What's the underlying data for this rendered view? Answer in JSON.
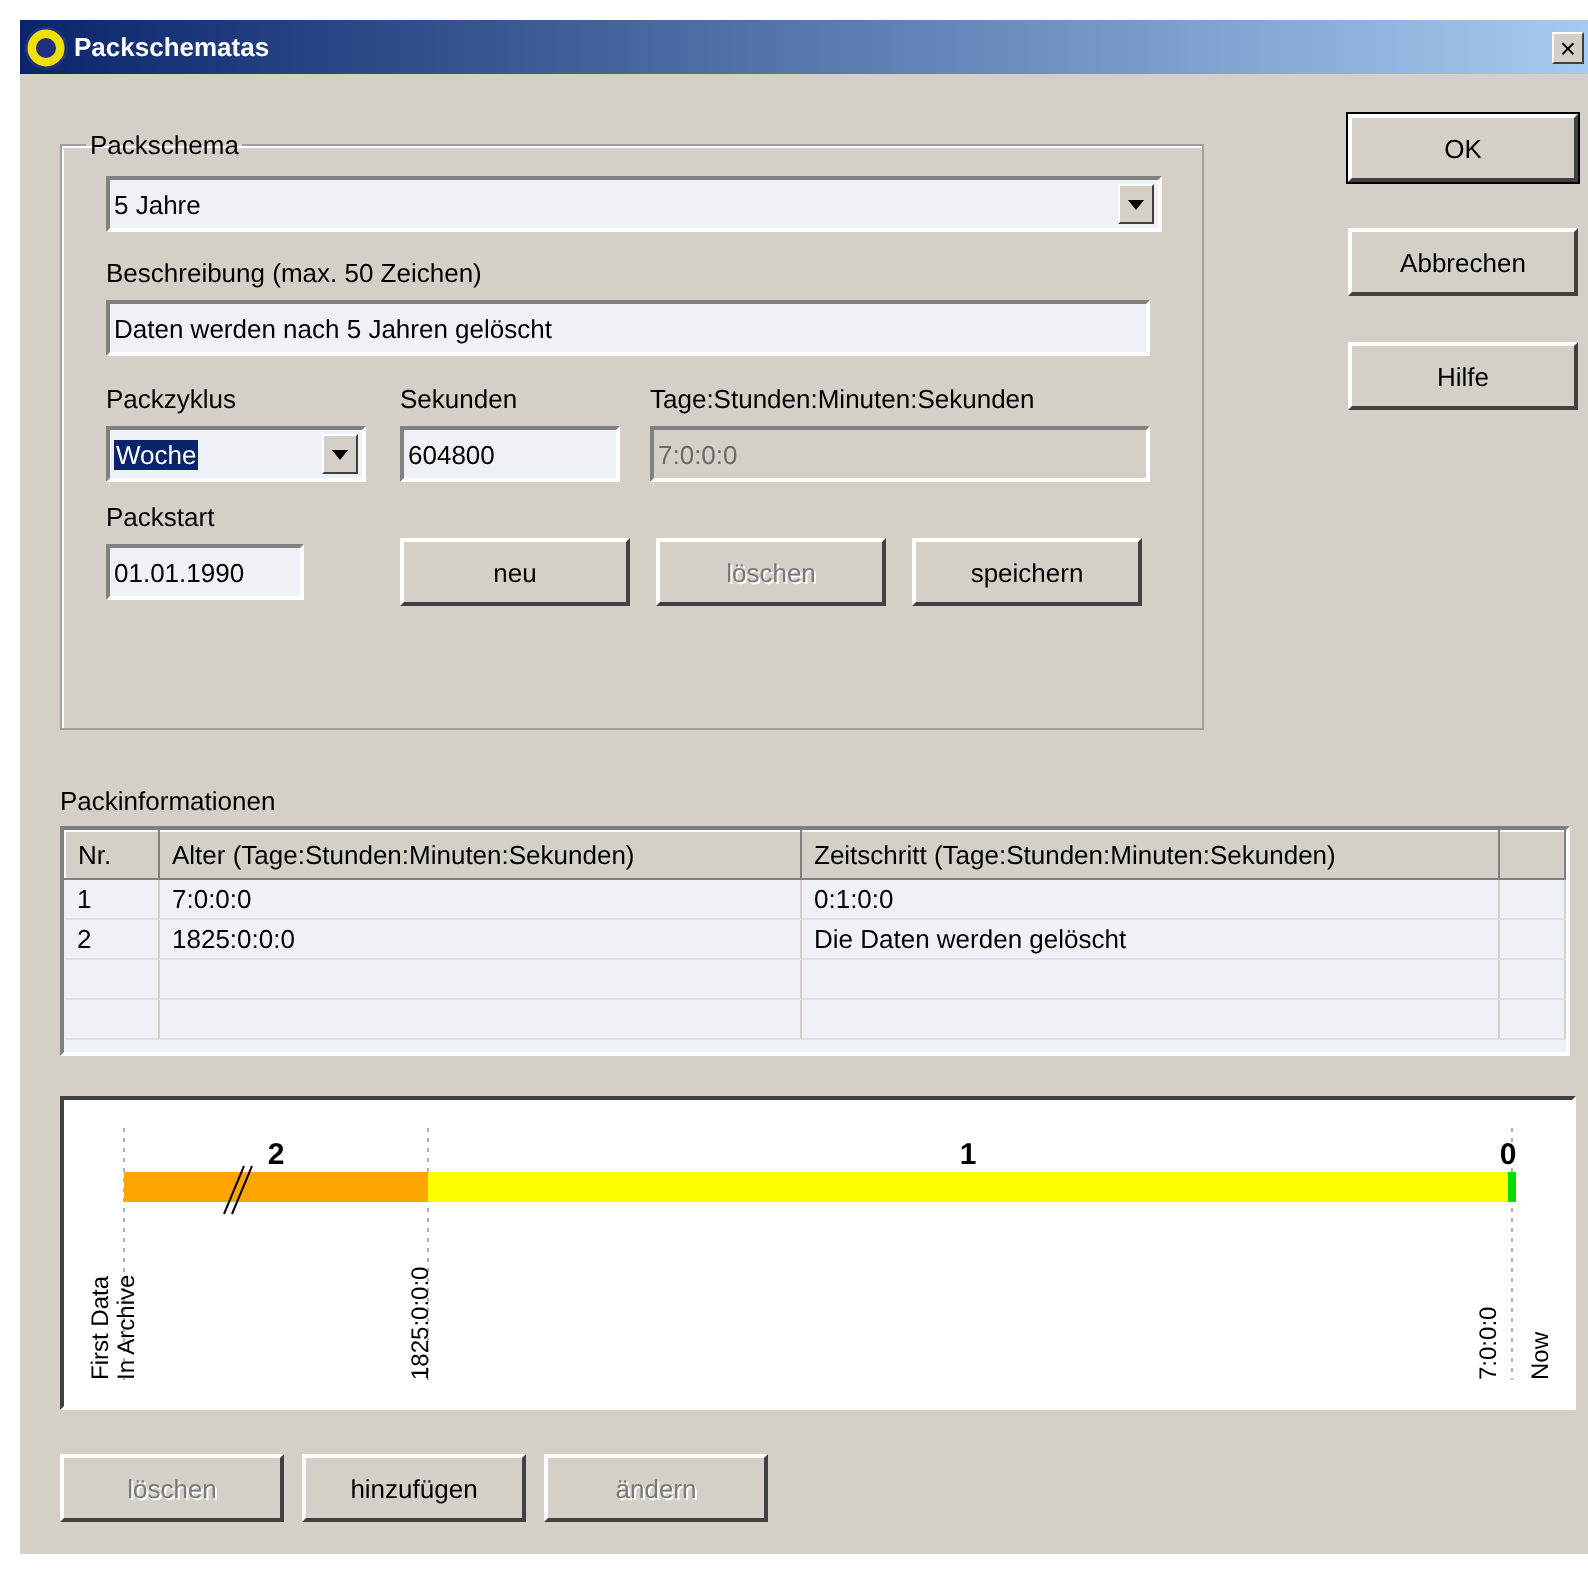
{
  "window": {
    "title": "Packschematas",
    "close": "×"
  },
  "packschema": {
    "legend": "Packschema",
    "scheme": {
      "value": "5 Jahre"
    },
    "description_label": "Beschreibung (max. 50 Zeichen)",
    "description": {
      "value": "Daten werden nach 5 Jahren gelöscht"
    },
    "cycle_label": "Packzyklus",
    "cycle": {
      "value": "Woche",
      "highlighted": true
    },
    "seconds_label": "Sekunden",
    "seconds": {
      "value": "604800",
      "disabled": false
    },
    "duration_label": "Tage:Stunden:Minuten:Sekunden",
    "duration": {
      "value": "7:0:0:0",
      "disabled": true
    },
    "start_label": "Packstart",
    "start": {
      "value": "01.01.1990"
    },
    "buttons": [
      {
        "label": "neu",
        "disabled": false
      },
      {
        "label": "löschen",
        "disabled": true
      },
      {
        "label": "speichern",
        "disabled": false
      }
    ]
  },
  "dialog_buttons": [
    {
      "label": "OK",
      "default": true
    },
    {
      "label": "Abbrechen",
      "default": false
    },
    {
      "label": "Hilfe",
      "default": false
    }
  ],
  "packinformationen": {
    "label": "Packinformationen",
    "columns": [
      "Nr.",
      "Alter (Tage:Stunden:Minuten:Sekunden)",
      "Zeitschritt (Tage:Stunden:Minuten:Sekunden)"
    ],
    "rows": [
      [
        "1",
        "7:0:0:0",
        "0:1:0:0"
      ],
      [
        "2",
        "1825:0:0:0",
        "Die Daten werden gelöscht"
      ]
    ]
  },
  "timeline": {
    "segments": [
      {
        "label": "2",
        "color": "#ffa500"
      },
      {
        "label": "1",
        "color": "#ffff00"
      },
      {
        "label": "0",
        "color": "#00dd00"
      }
    ],
    "marks": [
      {
        "lines": [
          "First Data",
          "In Archive"
        ]
      },
      {
        "lines": [
          "1825:0:0:0"
        ]
      },
      {
        "lines": [
          "7:0:0:0",
          "Now"
        ]
      }
    ]
  },
  "bottom_buttons": [
    {
      "label": "löschen",
      "disabled": true
    },
    {
      "label": "hinzufügen",
      "disabled": false
    },
    {
      "label": "ändern",
      "disabled": true
    }
  ]
}
